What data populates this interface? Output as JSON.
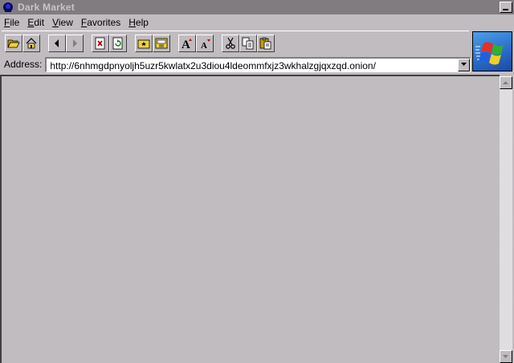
{
  "window": {
    "title": "Dark Market"
  },
  "menu": [
    {
      "label": "File"
    },
    {
      "label": "Edit"
    },
    {
      "label": "View"
    },
    {
      "label": "Favorites"
    },
    {
      "label": "Help"
    }
  ],
  "toolbar": {
    "buttons": [
      {
        "icon": "open-folder-icon"
      },
      {
        "icon": "home-icon"
      },
      {
        "icon": "back-icon"
      },
      {
        "icon": "forward-icon"
      },
      {
        "icon": "stop-icon"
      },
      {
        "icon": "refresh-icon"
      },
      {
        "icon": "favorites-icon"
      },
      {
        "icon": "history-icon"
      },
      {
        "icon": "font-larger-icon"
      },
      {
        "icon": "font-smaller-icon"
      },
      {
        "icon": "cut-icon"
      },
      {
        "icon": "copy-icon"
      },
      {
        "icon": "paste-icon"
      }
    ]
  },
  "address": {
    "label": "Address:",
    "value": "http://6nhmgdpnyoljh5uzr5kwlatx2u3diou4ldeommfxjz3wkhalzgjqxzqd.onion/"
  },
  "colors": {
    "title_bar": "#807c80",
    "face": "#c0bcc0",
    "content_bg": "#c0bcc0"
  }
}
